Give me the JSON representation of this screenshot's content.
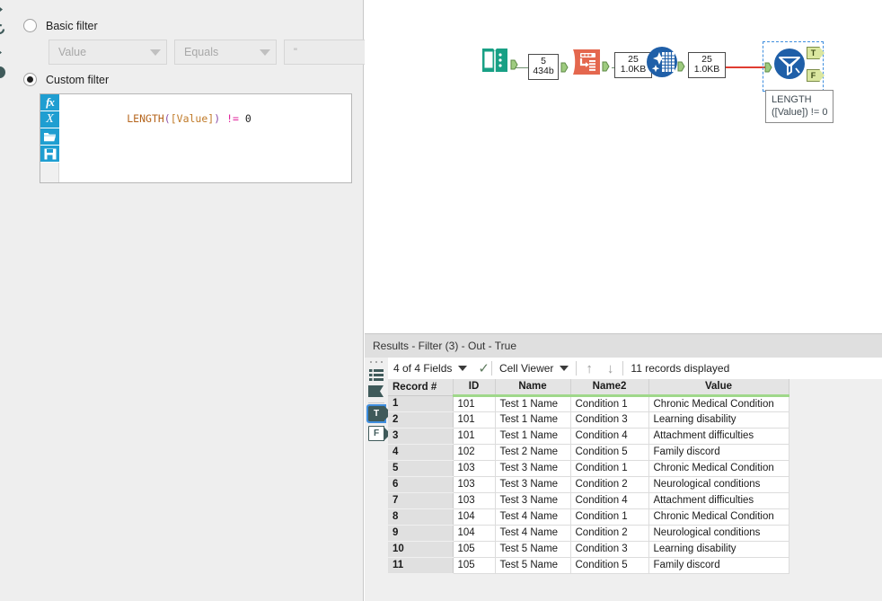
{
  "config_panel": {
    "edge_icons": [
      "chevron-right-icon",
      "refresh-icon",
      "chevron-right-icon",
      "circle-icon"
    ],
    "basic_filter": {
      "label": "Basic filter",
      "selected": false,
      "field_dropdown": {
        "value": "Value",
        "name": "field-dropdown"
      },
      "operator_dropdown": {
        "value": "Equals",
        "name": "operator-dropdown"
      },
      "text_value": "\""
    },
    "custom_filter": {
      "label": "Custom filter",
      "selected": true,
      "gutter_buttons": [
        "fx-icon",
        "variable-icon",
        "open-folder-icon",
        "save-icon"
      ],
      "expression_tokens": [
        {
          "text": "LENGTH",
          "cls": "tok-fn"
        },
        {
          "text": "(",
          "cls": "tok-par"
        },
        {
          "text": "[Value]",
          "cls": "tok-fld"
        },
        {
          "text": ")",
          "cls": "tok-par"
        },
        {
          "text": " ",
          "cls": "tok-num"
        },
        {
          "text": "!=",
          "cls": "tok-op"
        },
        {
          "text": " ",
          "cls": "tok-num"
        },
        {
          "text": "0",
          "cls": "tok-num"
        }
      ],
      "expression_plain": "LENGTH([Value]) != 0"
    }
  },
  "canvas": {
    "nodes": [
      {
        "name": "input-data-tool",
        "icon": "input-data-icon",
        "color": "#18a085"
      },
      {
        "name": "transpose-tool",
        "icon": "transpose-icon",
        "color": "#e4674e"
      },
      {
        "name": "data-cleansing-tool",
        "icon": "data-cleansing-icon",
        "color": "#1f5fa8"
      },
      {
        "name": "filter-tool",
        "icon": "filter-icon",
        "color": "#1f5fa8",
        "selected": true
      }
    ],
    "connections": [
      {
        "name": "conn-input-to-transpose",
        "records": "5",
        "size": "434b"
      },
      {
        "name": "conn-transpose-to-cleansing",
        "records": "25",
        "size": "1.0KB"
      },
      {
        "name": "conn-cleansing-to-filter",
        "records": "25",
        "size": "1.0KB"
      }
    ],
    "filter_outputs": [
      {
        "label": "T",
        "name": "filter-true-output"
      },
      {
        "label": "F",
        "name": "filter-false-output"
      }
    ],
    "annotation": {
      "line1": "LENGTH",
      "line2": "([Value]) != 0"
    }
  },
  "results": {
    "title": "Results - Filter (3) - Out - True",
    "sidebar": {
      "list_icon": "results-list-icon",
      "flag_icon": "results-flag-icon",
      "anchors": [
        {
          "label": "T",
          "name": "results-anchor-true",
          "selected": true
        },
        {
          "label": "F",
          "name": "results-anchor-false",
          "selected": false
        }
      ]
    },
    "toolbar": {
      "fields_label": "4 of 4 Fields",
      "check_icon": "checkmark-icon",
      "viewer_label": "Cell Viewer",
      "up_arrow": "↑",
      "down_arrow": "↓",
      "record_count": "11 records displayed"
    },
    "grid": {
      "columns": [
        "Record #",
        "ID",
        "Name",
        "Name2",
        "Value"
      ],
      "rows": [
        [
          "1",
          "101",
          "Test 1 Name",
          "Condition 1",
          "Chronic Medical Condition"
        ],
        [
          "2",
          "101",
          "Test 1 Name",
          "Condition 3",
          "Learning disability"
        ],
        [
          "3",
          "101",
          "Test 1 Name",
          "Condition 4",
          "Attachment difficulties"
        ],
        [
          "4",
          "102",
          "Test 2 Name",
          "Condition 5",
          "Family discord"
        ],
        [
          "5",
          "103",
          "Test 3 Name",
          "Condition 1",
          "Chronic Medical Condition"
        ],
        [
          "6",
          "103",
          "Test 3 Name",
          "Condition 2",
          "Neurological conditions"
        ],
        [
          "7",
          "103",
          "Test 3 Name",
          "Condition 4",
          "Attachment difficulties"
        ],
        [
          "8",
          "104",
          "Test 4 Name",
          "Condition 1",
          "Chronic Medical Condition"
        ],
        [
          "9",
          "104",
          "Test 4 Name",
          "Condition 2",
          "Neurological conditions"
        ],
        [
          "10",
          "105",
          "Test 5 Name",
          "Condition 3",
          "Learning disability"
        ],
        [
          "11",
          "105",
          "Test 5 Name",
          "Condition 5",
          "Family discord"
        ]
      ]
    }
  }
}
